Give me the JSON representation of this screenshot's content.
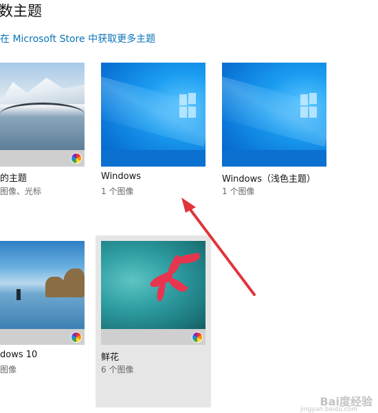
{
  "header": {
    "title": "数主题",
    "store_link": "在 Microsoft Store 中获取更多主题"
  },
  "themes": [
    {
      "name": "的主题",
      "detail": "图像、光标",
      "icon": "color-wheel-icon"
    },
    {
      "name": "Windows",
      "detail": "1 个图像"
    },
    {
      "name": "Windows（浅色主题）",
      "detail": "1 个图像"
    },
    {
      "name": "dows 10",
      "detail": "图像",
      "icon": "color-wheel-icon"
    },
    {
      "name": "鲜花",
      "detail": "6 个图像",
      "icon": "color-wheel-icon",
      "selected": true
    }
  ],
  "annotation": {
    "arrow_color": "#e0343a"
  },
  "watermark": {
    "brand": "Bai度经验",
    "url": "jingyan.baidu.com"
  }
}
